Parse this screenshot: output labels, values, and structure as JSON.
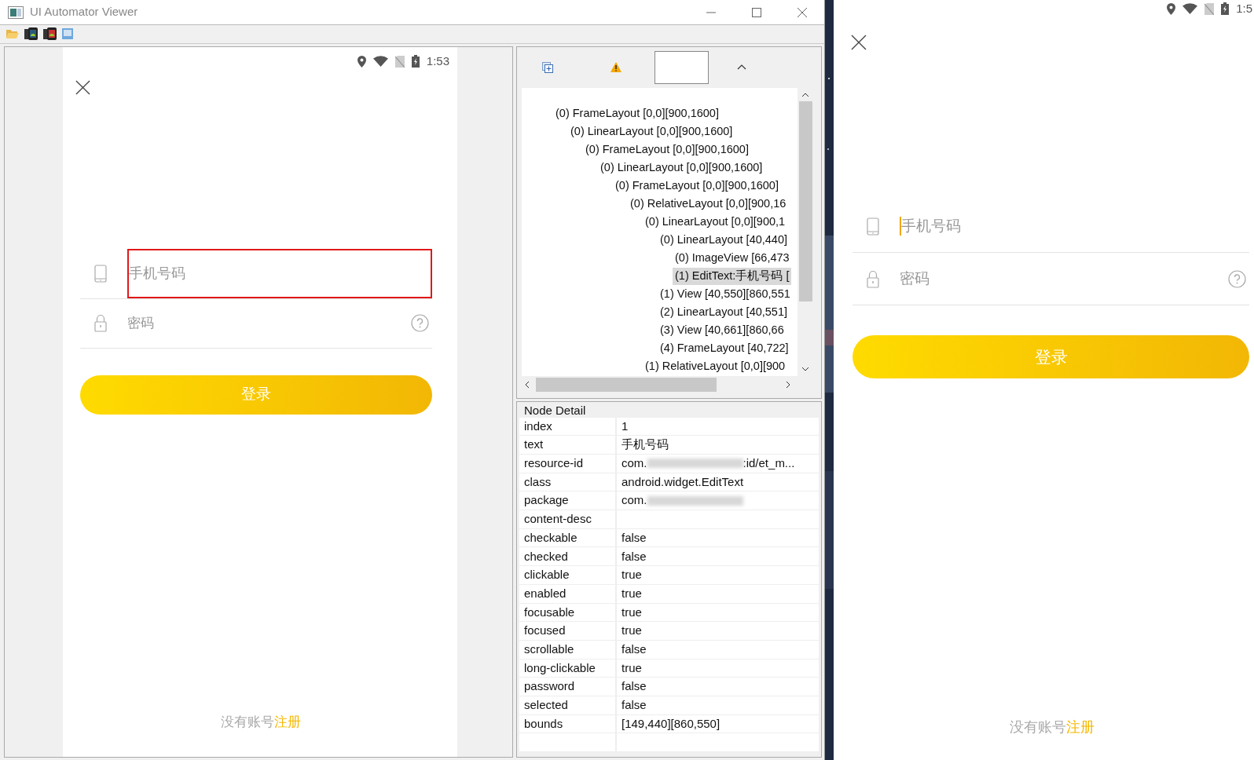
{
  "window": {
    "title": "UI Automator Viewer"
  },
  "screenshot": {
    "status_time": "1:53",
    "phone_placeholder": "手机号码",
    "password_placeholder": "密码",
    "login_button": "登录",
    "footer": {
      "text": "没有账号",
      "link": "注册"
    },
    "phone_highlighted": true
  },
  "tree": {
    "items": [
      {
        "label": "(0) FrameLayout [0,0][900,1600]",
        "selected": false,
        "children": [
          {
            "label": "(0) LinearLayout [0,0][900,1600]",
            "selected": false,
            "children": [
              {
                "label": "(0) FrameLayout [0,0][900,1600]",
                "selected": false,
                "children": [
                  {
                    "label": "(0) LinearLayout [0,0][900,1600]",
                    "selected": false,
                    "children": [
                      {
                        "label": "(0) FrameLayout [0,0][900,1600]",
                        "selected": false,
                        "children": [
                          {
                            "label": "(0) RelativeLayout [0,0][900,16",
                            "selected": false,
                            "children": [
                              {
                                "label": "(0) LinearLayout [0,0][900,1",
                                "selected": false,
                                "children": [
                                  {
                                    "label": "(0) LinearLayout [40,440]",
                                    "selected": false,
                                    "children": [
                                      {
                                        "label": "(0) ImageView [66,473",
                                        "selected": false
                                      },
                                      {
                                        "label": "(1) EditText:手机号码 [",
                                        "selected": true
                                      }
                                    ]
                                  },
                                  {
                                    "label": "(1) View [40,550][860,551",
                                    "selected": false
                                  },
                                  {
                                    "label": "(2) LinearLayout [40,551]",
                                    "selected": false
                                  },
                                  {
                                    "label": "(3) View [40,661][860,66",
                                    "selected": false
                                  },
                                  {
                                    "label": "(4) FrameLayout [40,722]",
                                    "selected": false
                                  }
                                ]
                              },
                              {
                                "label": "(1) RelativeLayout [0,0][900",
                                "selected": false
                              }
                            ]
                          }
                        ]
                      }
                    ]
                  }
                ]
              }
            ]
          }
        ]
      }
    ]
  },
  "node_detail": {
    "title": "Node Detail",
    "rows": [
      {
        "key": "index",
        "value": "1"
      },
      {
        "key": "text",
        "value": "手机号码"
      },
      {
        "key": "resource-id",
        "value": "com.",
        "value_end": ":id/et_m...",
        "redacted": true
      },
      {
        "key": "class",
        "value": "android.widget.EditText"
      },
      {
        "key": "package",
        "value": "com.",
        "redacted": true
      },
      {
        "key": "content-desc"
      },
      {
        "key": "checkable",
        "value": "false"
      },
      {
        "key": "checked",
        "value": "false"
      },
      {
        "key": "clickable",
        "value": "true"
      },
      {
        "key": "enabled",
        "value": "true"
      },
      {
        "key": "focusable",
        "value": "true"
      },
      {
        "key": "focused",
        "value": "true"
      },
      {
        "key": "scrollable",
        "value": "false"
      },
      {
        "key": "long-clickable",
        "value": "true"
      },
      {
        "key": "password",
        "value": "false"
      },
      {
        "key": "selected",
        "value": "false"
      },
      {
        "key": "bounds",
        "value": "[149,440][860,550]"
      }
    ]
  },
  "device": {
    "status_time": "1:5",
    "phone_placeholder": "手机号码",
    "password_placeholder": "密码",
    "login_button": "登录",
    "footer": {
      "text": "没有账号",
      "link": "注册"
    },
    "phone_focused": true
  }
}
